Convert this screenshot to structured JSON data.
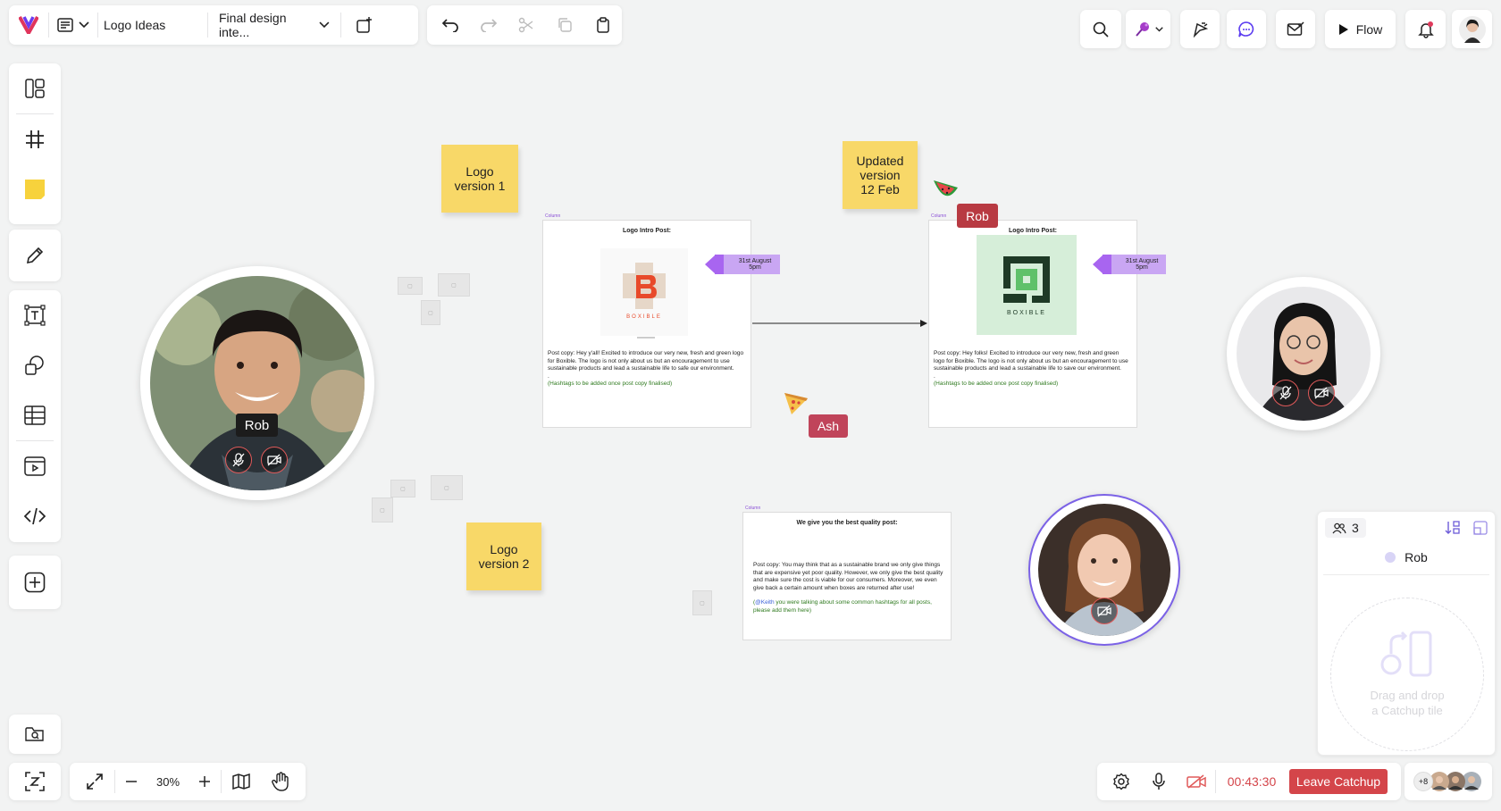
{
  "header": {
    "board_name": "Logo Ideas",
    "frame_name": "Final design inte...",
    "flow_label": "Flow"
  },
  "stickies": {
    "v1": "Logo version 1",
    "v1_l1": "Logo",
    "v1_l2": "version 1",
    "updated_l1": "Updated",
    "updated_l2": "version",
    "updated_l3": "12 Feb",
    "v2_l1": "Logo",
    "v2_l2": "version 2"
  },
  "cards": {
    "tag": "Column",
    "card1": {
      "title": "Logo Intro Post:",
      "logo_text": "BOXIBLE",
      "copy": "Post copy: Hey y'all! Excited to introduce our very new, fresh and green logo for Boxible. The logo is not only about us but an encouragement to use sustainable products and lead a sustainable life to safe our environment.",
      "dot": ".",
      "hashtags": "(Hashtags to be added once post copy finalised)",
      "date_l1": "31st August",
      "date_l2": "5pm"
    },
    "card2": {
      "title": "Logo Intro Post:",
      "logo_text": "BOXIBLE",
      "copy": "Post copy: Hey folks! Excited to introduce our very new, fresh and green logo for Boxible. The logo is not only about us but an encouragement to use sustainable products and lead a sustainable life to save our environment.",
      "dot": ".",
      "hashtags": "(Hashtags to be added once post copy finalised)",
      "date_l1": "31st August",
      "date_l2": "5pm"
    },
    "card3": {
      "title": "We give you the best quality post:",
      "copy": "Post copy: You may think that as a sustainable brand we only give things that are expensive yet poor quality. However, we only give the best quality and make sure the cost is viable for our consumers. Moreover, we even give back a certain amount when boxes are returned after use!",
      "mention": "@Keith",
      "note": " you were talking about some common hashtags for all posts, please add them here)"
    }
  },
  "cursors": {
    "rob": "Rob",
    "ash": "Ash"
  },
  "participants": {
    "rob_name": "Rob"
  },
  "catchup": {
    "count": "3",
    "member": "Rob",
    "drop_l1": "Drag and drop",
    "drop_l2": "a Catchup tile"
  },
  "zoom": {
    "level": "30%"
  },
  "call": {
    "timer": "00:43:30",
    "leave_label": "Leave Catchup",
    "more_count": "+8"
  },
  "colors": {
    "leave": "#d4454a",
    "sticky": "#f8d868",
    "tag_purple": "#a865f0",
    "rob_label": "#b83a42",
    "ash_label": "#c0445a"
  }
}
